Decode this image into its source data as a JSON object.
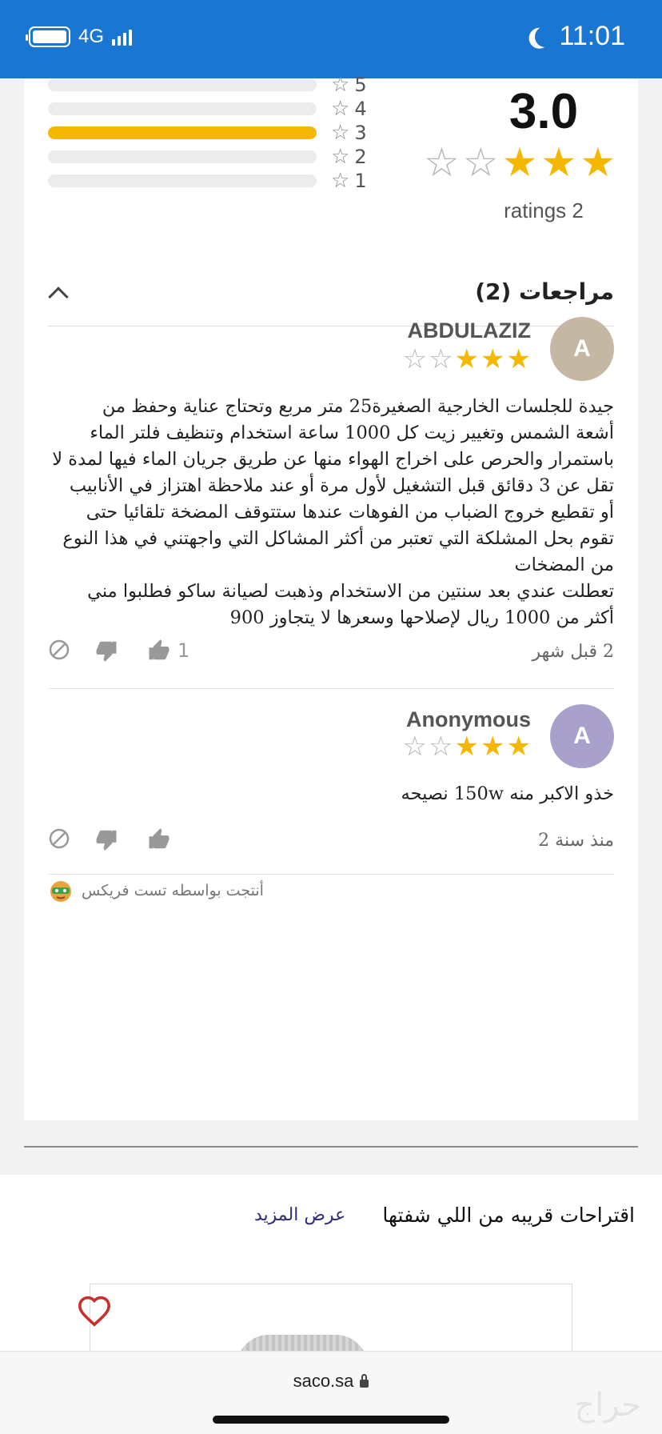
{
  "status_bar": {
    "network": "4G",
    "time": "11:01",
    "battery_level": 1.0
  },
  "rating_summary": {
    "average": "3.0",
    "ratings_label": "ratings 2",
    "stars_filled": 3,
    "stars_total": 5,
    "histogram": [
      {
        "label": "5",
        "fraction": 0.0
      },
      {
        "label": "4",
        "fraction": 0.0
      },
      {
        "label": "3",
        "fraction": 1.0
      },
      {
        "label": "2",
        "fraction": 0.0
      },
      {
        "label": "1",
        "fraction": 0.0
      }
    ]
  },
  "reviews_section": {
    "title": "مراجعات (2)"
  },
  "reviews": [
    {
      "avatar_letter": "A",
      "avatar_color": "#c4b8a4",
      "author": "ABDULAZIZ",
      "stars": 3,
      "lines": [
        "جيدة للجلسات الخارجية الصغيرة25 متر مربع وتحتاج عناية وحفظ من",
        "أشعة الشمس وتغيير زيت كل 1000 ساعة استخدام وتنظيف فلتر الماء",
        "باستمرار والحرص على اخراج الهواء منها عن طريق جريان الماء فيها لمدة لا",
        "تقل عن 3 دقائق قبل التشغيل لأول مرة أو عند ملاحظة اهتزاز في الأنابيب",
        "أو تقطيع خروج الضباب من الفوهات عندها ستتوقف المضخة تلقائيا حتى",
        "تقوم بحل المشلكة التي تعتبر من أكثر المشاكل التي واجهتني في هذا النوع",
        "من المضخات",
        "تعطلت عندي بعد سنتين من الاستخدام وذهبت لصيانة ساكو فطلبوا مني",
        "أكثر من 1000 ريال لإصلاحها وسعرها لا يتجاوز 900"
      ],
      "date": "2 قبل شهر",
      "likes": "1"
    },
    {
      "avatar_letter": "A",
      "avatar_color": "#a9a1cc",
      "author": "Anonymous",
      "stars": 3,
      "lines": [
        "خذو الاكبر منه 150w نصيحه"
      ],
      "date": "منذ سنة 2",
      "likes": ""
    }
  ],
  "powered_by": "أنتجت بواسطه تست فريكس",
  "suggestions": {
    "title": "اقتراحات قريبه من اللي شفتها",
    "more_link": "عرض المزيد"
  },
  "browser": {
    "url": "saco.sa",
    "watermark": "حراج"
  },
  "colors": {
    "status_bar": "#1976d2",
    "star_filled": "#f5b800",
    "star_empty": "#b5b5b5"
  }
}
